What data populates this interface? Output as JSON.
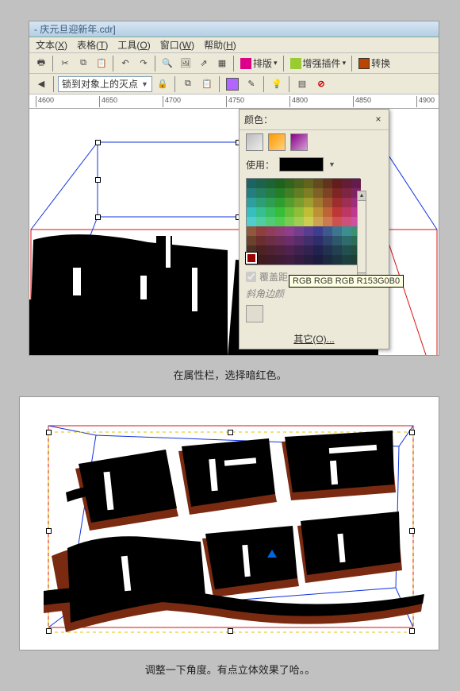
{
  "titlebar": {
    "filename": "- 庆元旦迎新年.cdr]"
  },
  "menubar": {
    "items": [
      {
        "label": "文本",
        "key": "X"
      },
      {
        "label": "表格",
        "key": "T"
      },
      {
        "label": "工具",
        "key": "O"
      },
      {
        "label": "窗口",
        "key": "W"
      },
      {
        "label": "帮助",
        "key": "H"
      }
    ]
  },
  "toolbar1": {
    "groups": {
      "layout_label": "排版",
      "enhance_label": "增强插件",
      "convert_label": "转换"
    }
  },
  "toolbar2": {
    "snap_combo": "锁到对象上的灭点"
  },
  "ruler": {
    "ticks": [
      "4600",
      "4650",
      "4700",
      "4750",
      "4800",
      "4850",
      "4900"
    ]
  },
  "color_palette": {
    "header_label": "颜色：",
    "use_label": "使用：",
    "cover_label": "覆盖距",
    "bevel_label": "斜角边颜",
    "tooltip": "RGB RGB RGB R153G0B0",
    "other_label": "其它(O)..."
  },
  "caption1": "在属性栏，选择暗红色。",
  "caption2": "调整一下角度。有点立体效果了哈。。"
}
